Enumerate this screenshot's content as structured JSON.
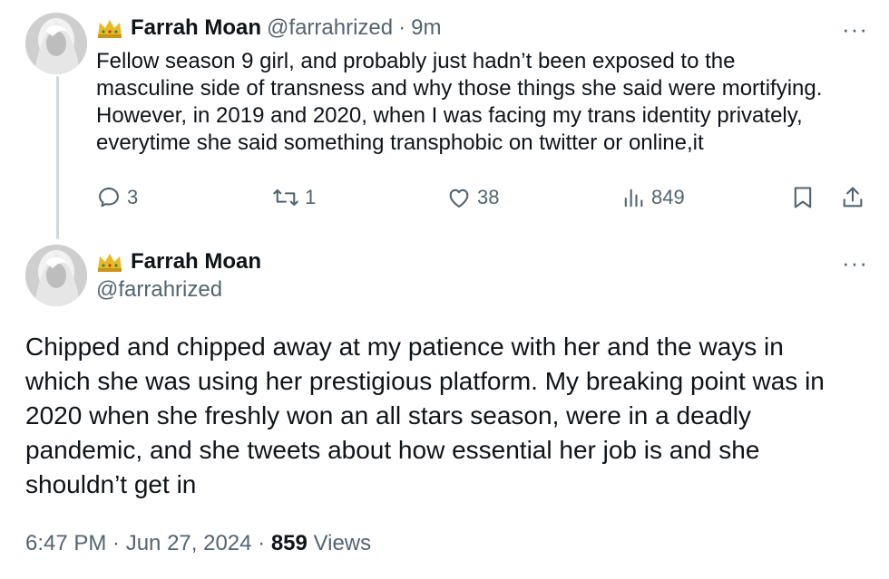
{
  "tweet1": {
    "display_name": "Farrah Moan",
    "handle": "@farrahrized",
    "time": "9m",
    "separator": "·",
    "more": "···",
    "text_lines": [
      "Fellow season 9 girl, and probably just hadn’t been exposed to the",
      "masculine side of transness and why those things she said were mortifying.",
      "However, in 2019 and 2020, when I was facing my trans identity privately,",
      "everytime she said something transphobic on twitter or online,it"
    ],
    "actions": {
      "replies": "3",
      "reposts": "1",
      "likes": "38",
      "views": "849"
    },
    "icons": [
      "reply-icon",
      "repost-icon",
      "like-icon",
      "views-icon",
      "bookmark-icon",
      "share-icon"
    ]
  },
  "tweet2": {
    "display_name": "Farrah Moan",
    "handle": "@farrahrized",
    "more": "···",
    "text_lines": [
      "Chipped and chipped away at my patience with her and the ways in",
      "which she was using her prestigious platform. My breaking point was in",
      "2020 when she freshly won an all stars season, were in a deadly",
      "pandemic, and she tweets about how essential her job is and she",
      "shouldn’t get in"
    ],
    "timestamp": "6:47 PM · Jun 27, 2024 · ",
    "views_count": "859",
    "views_label": " Views"
  },
  "colors": {
    "text": "#0f1419",
    "secondary": "#536471",
    "thread_line": "#cfd9de",
    "crown": "#e8b923"
  }
}
